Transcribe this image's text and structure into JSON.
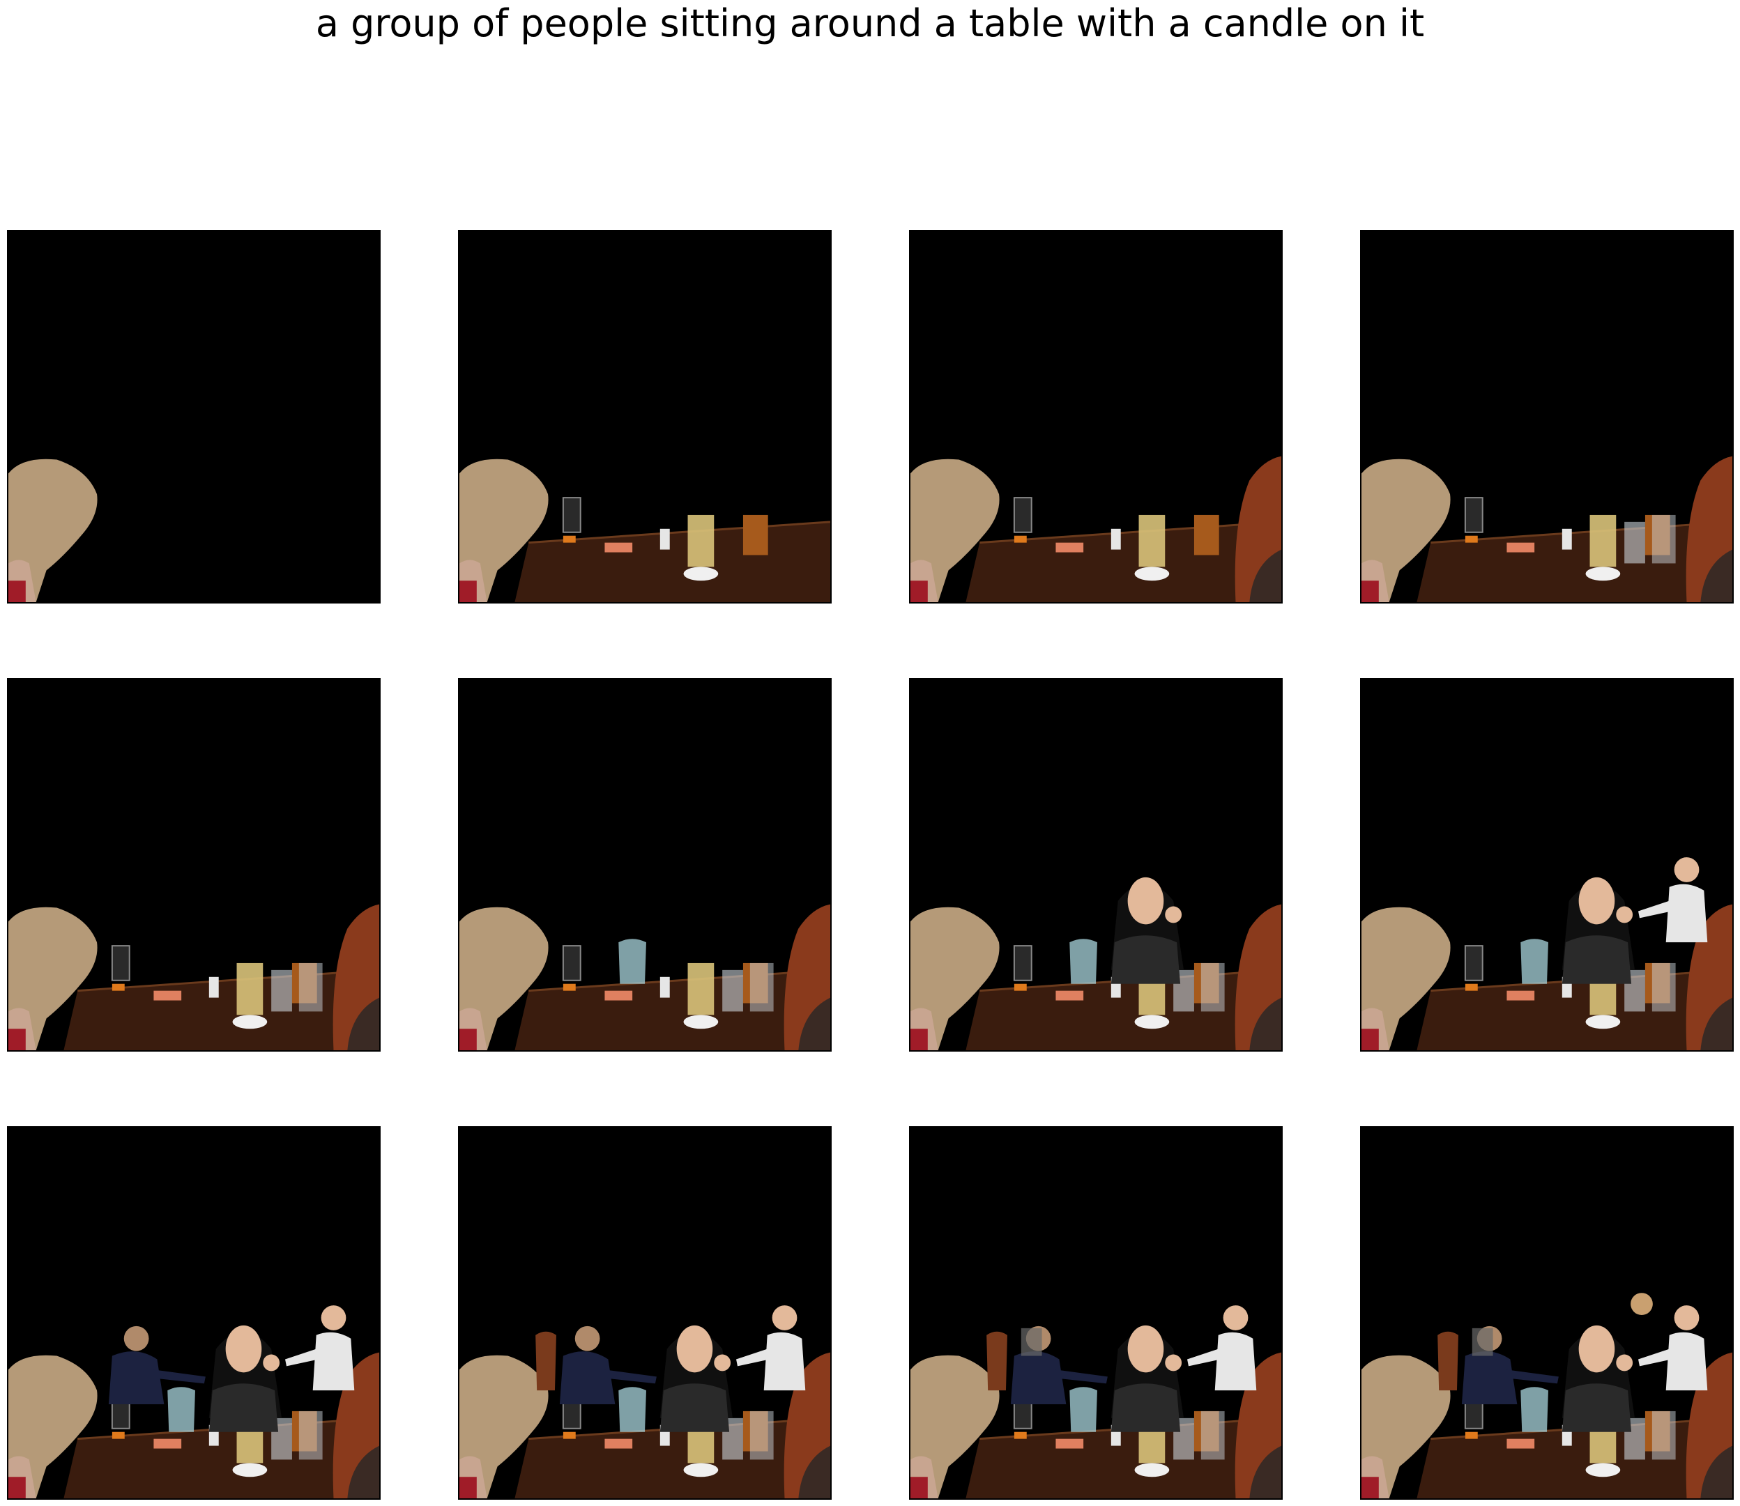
{
  "figure": {
    "title": "a group of people sitting around a table with a candle on it"
  },
  "panels": [
    {
      "id": 1,
      "visible_layers": [
        "boy-head"
      ]
    },
    {
      "id": 2,
      "visible_layers": [
        "boy-head",
        "table",
        "drinks"
      ]
    },
    {
      "id": 3,
      "visible_layers": [
        "boy-head",
        "table",
        "drinks",
        "red-hair-person"
      ]
    },
    {
      "id": 4,
      "visible_layers": [
        "boy-head",
        "table",
        "drinks",
        "red-hair-person",
        "glasses"
      ]
    },
    {
      "id": 5,
      "visible_layers": [
        "boy-head",
        "table",
        "drinks",
        "red-hair-person",
        "glasses"
      ]
    },
    {
      "id": 6,
      "visible_layers": [
        "boy-head",
        "table",
        "drinks",
        "red-hair-person",
        "glasses",
        "pitcher"
      ]
    },
    {
      "id": 7,
      "visible_layers": [
        "boy-head",
        "table",
        "drinks",
        "red-hair-person",
        "glasses",
        "pitcher",
        "woman-center"
      ]
    },
    {
      "id": 8,
      "visible_layers": [
        "boy-head",
        "table",
        "drinks",
        "red-hair-person",
        "glasses",
        "pitcher",
        "woman-center",
        "man-white-shirt"
      ]
    },
    {
      "id": 9,
      "visible_layers": [
        "boy-head",
        "table",
        "drinks",
        "red-hair-person",
        "glasses",
        "pitcher",
        "woman-center",
        "man-white-shirt",
        "man-dark-shirt"
      ]
    },
    {
      "id": 10,
      "visible_layers": [
        "boy-head",
        "table",
        "drinks",
        "red-hair-person",
        "glasses",
        "pitcher",
        "woman-center",
        "man-white-shirt",
        "man-dark-shirt",
        "chair"
      ]
    },
    {
      "id": 11,
      "visible_layers": [
        "boy-head",
        "table",
        "drinks",
        "red-hair-person",
        "glasses",
        "pitcher",
        "woman-center",
        "man-white-shirt",
        "man-dark-shirt",
        "chair",
        "extra-detail"
      ]
    },
    {
      "id": 12,
      "visible_layers": [
        "boy-head",
        "table",
        "drinks",
        "red-hair-person",
        "glasses",
        "pitcher",
        "woman-center",
        "man-white-shirt",
        "man-dark-shirt",
        "chair",
        "extra-detail",
        "far-person"
      ]
    }
  ],
  "colors": {
    "background": "#000000",
    "table": "#3a1c0e",
    "hair_blond": "#b59a78",
    "hair_red": "#8a3a1c",
    "skin": "#e3b99a",
    "drink_yellow": "#d9c37a",
    "drink_amber": "#a65a1c",
    "shirt_white": "#e6e6e6",
    "shirt_dark": "#1c2240"
  }
}
